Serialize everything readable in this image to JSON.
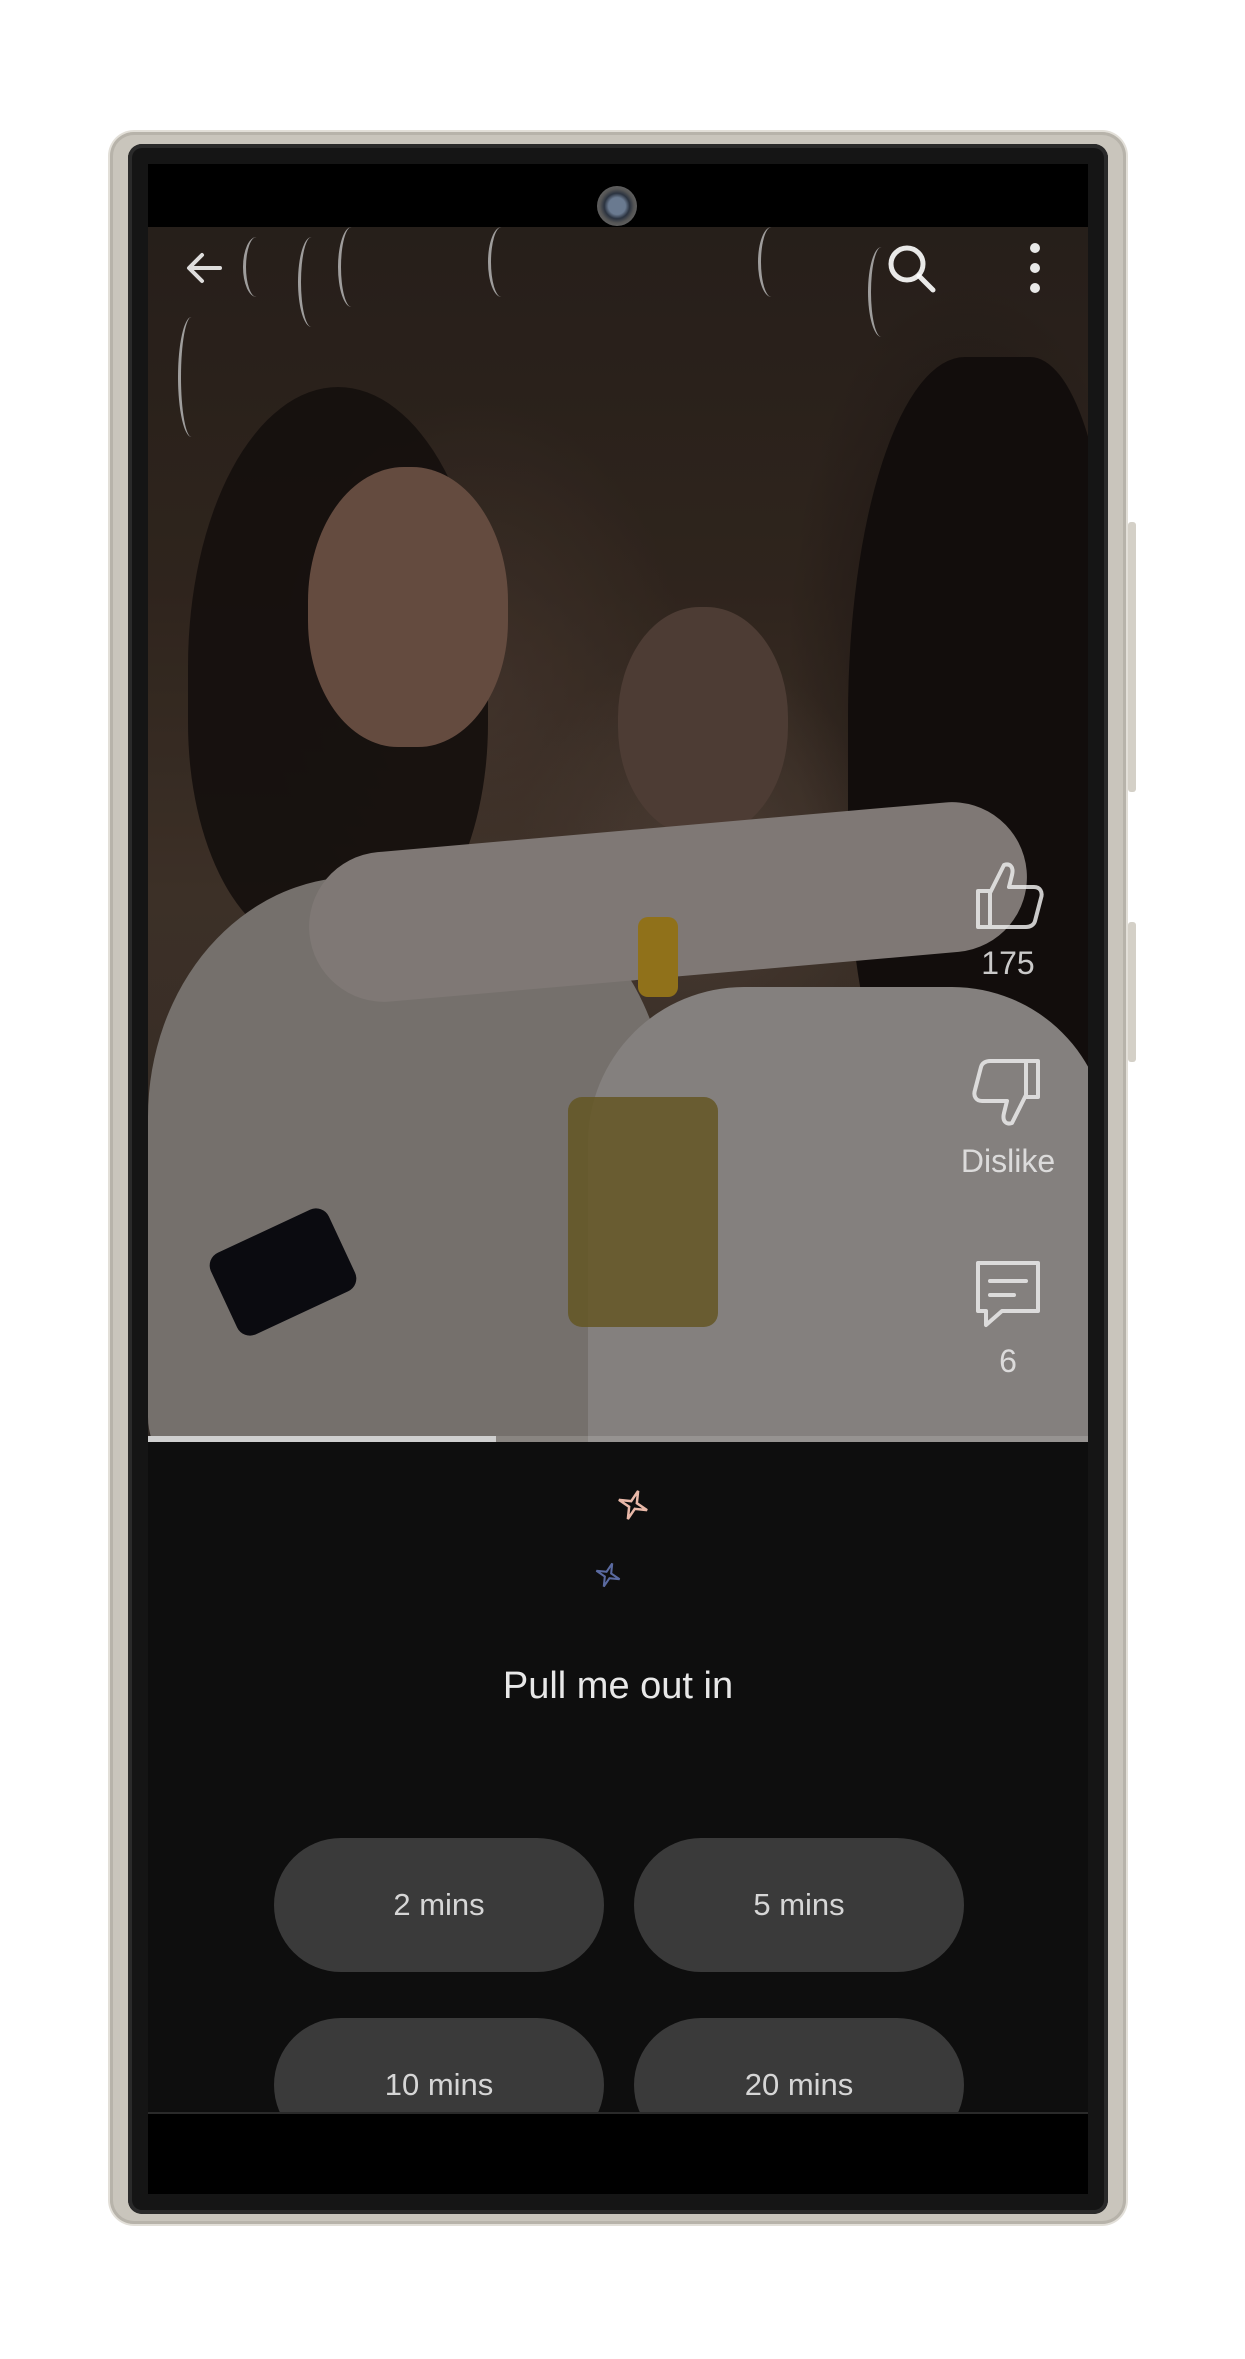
{
  "video": {
    "progress": 0.37,
    "actions": {
      "like_count": "175",
      "dislike_label": "Dislike",
      "comment_count": "6"
    }
  },
  "icons": {
    "back": "arrow-left-icon",
    "search": "search-icon",
    "more": "more-vertical-icon",
    "like": "thumbs-up-icon",
    "dislike": "thumbs-down-icon",
    "comments": "comment-icon",
    "sparkle": "sparkle-icon"
  },
  "timer_panel": {
    "title": "Pull me out in",
    "options": [
      "2 mins",
      "5 mins",
      "10 mins",
      "20 mins"
    ]
  },
  "colors": {
    "panel_bg": "#0e0e0e",
    "pill_bg": "#3a3a3a",
    "sparkle_top": "#e8b8a8",
    "sparkle_bottom": "#5a6aa0"
  }
}
